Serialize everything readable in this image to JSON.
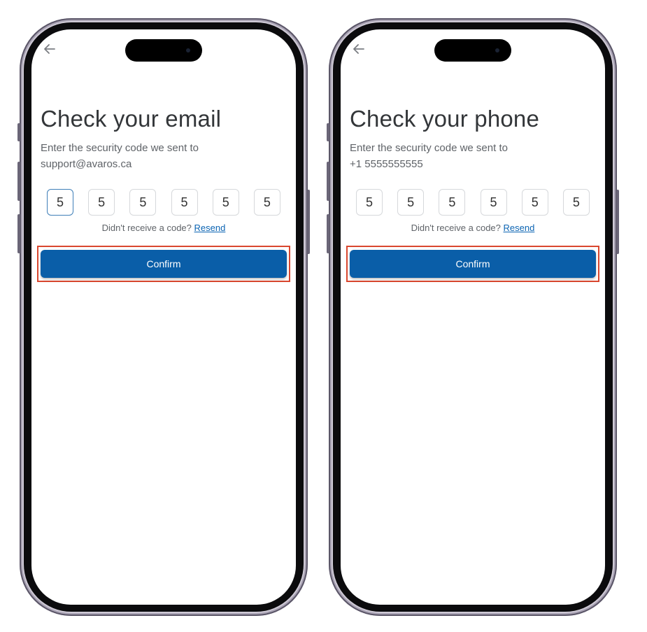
{
  "colors": {
    "accent": "#0a5ea8",
    "highlight_border": "#d9472f",
    "link": "#0b64b3"
  },
  "screens": [
    {
      "back_icon": "arrow-left-icon",
      "title": "Check your email",
      "subtitle_line1": "Enter the security code we sent to",
      "subtitle_line2": "support@avaros.ca",
      "code_digits": [
        "5",
        "5",
        "5",
        "5",
        "5",
        "5"
      ],
      "resend_prompt": "Didn't receive a code?",
      "resend_label": "Resend",
      "confirm_label": "Confirm"
    },
    {
      "back_icon": "arrow-left-icon",
      "title": "Check your phone",
      "subtitle_line1": "Enter the security code we sent to",
      "subtitle_line2": "+1 5555555555",
      "code_digits": [
        "5",
        "5",
        "5",
        "5",
        "5",
        "5"
      ],
      "resend_prompt": "Didn't receive a code?",
      "resend_label": "Resend",
      "confirm_label": "Confirm"
    }
  ]
}
